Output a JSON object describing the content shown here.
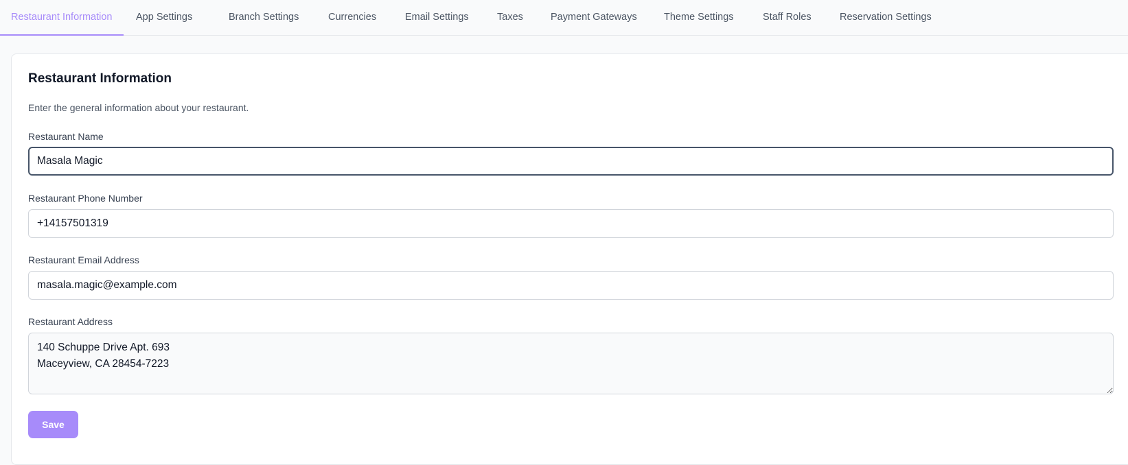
{
  "tabs": [
    {
      "label": "Restaurant Information",
      "active": true
    },
    {
      "label": "App Settings"
    },
    {
      "label": "Branch Settings"
    },
    {
      "label": "Currencies"
    },
    {
      "label": "Email Settings"
    },
    {
      "label": "Taxes"
    },
    {
      "label": "Payment Gateways"
    },
    {
      "label": "Theme Settings"
    },
    {
      "label": "Staff Roles"
    },
    {
      "label": "Reservation Settings"
    }
  ],
  "form": {
    "title": "Restaurant Information",
    "description": "Enter the general information about your restaurant.",
    "name_label": "Restaurant Name",
    "name_value": "Masala Magic",
    "phone_label": "Restaurant Phone Number",
    "phone_value": "+14157501319",
    "email_label": "Restaurant Email Address",
    "email_value": "masala.magic@example.com",
    "address_label": "Restaurant Address",
    "address_value": "140 Schuppe Drive Apt. 693\nMaceyview, CA 28454-7223",
    "save_label": "Save"
  },
  "colors": {
    "accent": "#a78bfa",
    "focus_border": "#475569"
  }
}
